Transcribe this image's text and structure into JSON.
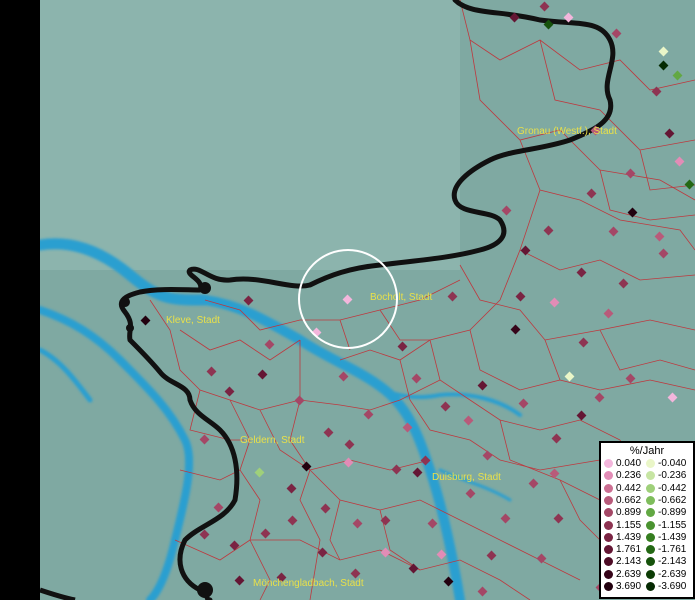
{
  "map": {
    "labels": {
      "gronau": "Gronau (Westf.), Stadt",
      "bocholt": "Bocholt, Stadt",
      "kleve": "Kleve, Stadt",
      "geldern": "Geldern, Stadt",
      "duisburg": "Duisburg, Stadt",
      "moenchengladbach": "Mönchengladbach, Stadt"
    }
  },
  "legend": {
    "title": "%/Jahr",
    "positive": [
      "0.040",
      "0.236",
      "0.442",
      "0.662",
      "0.899",
      "1.155",
      "1.439",
      "1.761",
      "2.143",
      "2.639",
      "3.690"
    ],
    "negative": [
      "-0.040",
      "-0.236",
      "-0.442",
      "-0.662",
      "-0.899",
      "-1.155",
      "-1.439",
      "-1.761",
      "-2.143",
      "-2.639",
      "-3.690"
    ],
    "positive_colors": [
      "#f3b6dc",
      "#e28cb6",
      "#cc6f92",
      "#b85a7a",
      "#a44766",
      "#8e3452",
      "#7a2443",
      "#641634",
      "#4e0c26",
      "#36051a",
      "#22010f"
    ],
    "negative_colors": [
      "#eaf6c8",
      "#c7e5a3",
      "#9fd07a",
      "#7fbd5c",
      "#62a843",
      "#4a9330",
      "#367e20",
      "#246814",
      "#16520b",
      "#0c3c05",
      "#052a02"
    ]
  },
  "colors": {
    "land": "#7fa9a2",
    "water": "#2a9fd0",
    "border": "#111111",
    "admin_lines": "#c0343a",
    "label": "#e8e04a"
  }
}
